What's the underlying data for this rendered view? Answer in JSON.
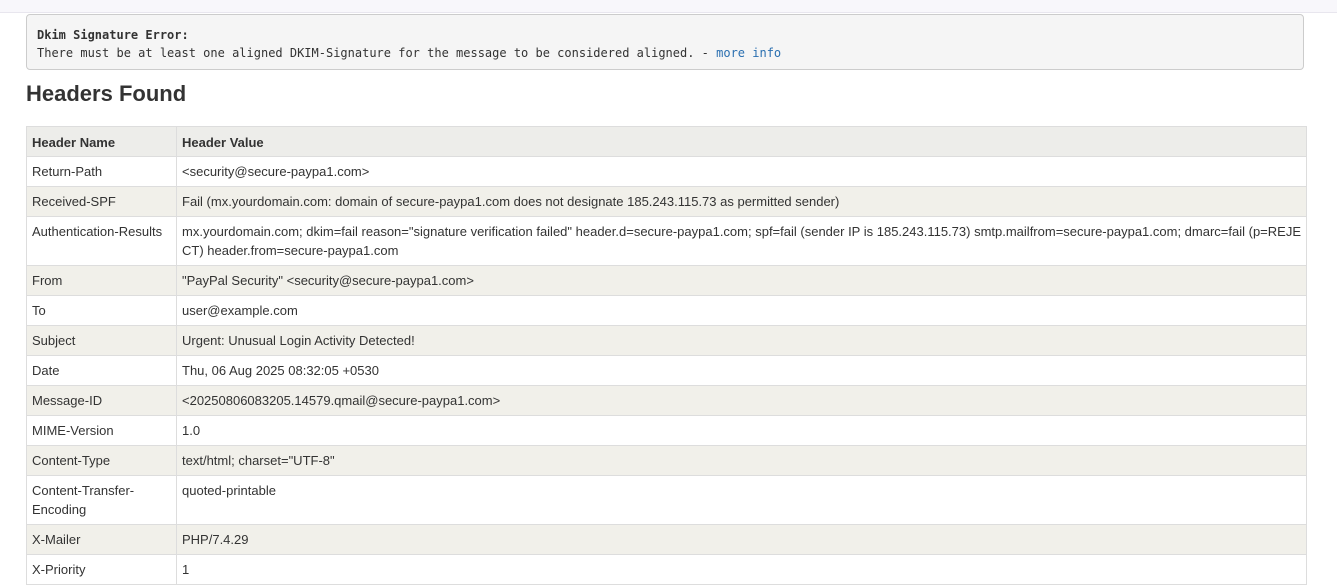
{
  "error": {
    "title": "Dkim Signature Error:",
    "message": "There must be at least one aligned DKIM-Signature for the message to be considered aligned. - ",
    "link_text": "more info"
  },
  "section_title": "Headers Found",
  "table": {
    "columns": [
      "Header Name",
      "Header Value"
    ],
    "rows": [
      {
        "name": "Return-Path",
        "value": "<security@secure-paypa1.com>"
      },
      {
        "name": "Received-SPF",
        "value": "Fail (mx.yourdomain.com: domain of secure-paypa1.com does not designate 185.243.115.73 as permitted sender)"
      },
      {
        "name": "Authentication-Results",
        "value": "mx.yourdomain.com; dkim=fail reason=\"signature verification failed\" header.d=secure-paypa1.com; spf=fail (sender IP is 185.243.115.73) smtp.mailfrom=secure-paypa1.com; dmarc=fail (p=REJECT) header.from=secure-paypa1.com"
      },
      {
        "name": "From",
        "value": "\"PayPal Security\" <security@secure-paypa1.com>"
      },
      {
        "name": "To",
        "value": "user@example.com"
      },
      {
        "name": "Subject",
        "value": "Urgent: Unusual Login Activity Detected!"
      },
      {
        "name": "Date",
        "value": "Thu, 06 Aug 2025 08:32:05 +0530"
      },
      {
        "name": "Message-ID",
        "value": "<20250806083205.14579.qmail@secure-paypa1.com>"
      },
      {
        "name": "MIME-Version",
        "value": "1.0"
      },
      {
        "name": "Content-Type",
        "value": "text/html; charset=\"UTF-8\""
      },
      {
        "name": "Content-Transfer-Encoding",
        "value": "quoted-printable"
      },
      {
        "name": "X-Mailer",
        "value": "PHP/7.4.29"
      },
      {
        "name": "X-Priority",
        "value": "1"
      }
    ]
  }
}
